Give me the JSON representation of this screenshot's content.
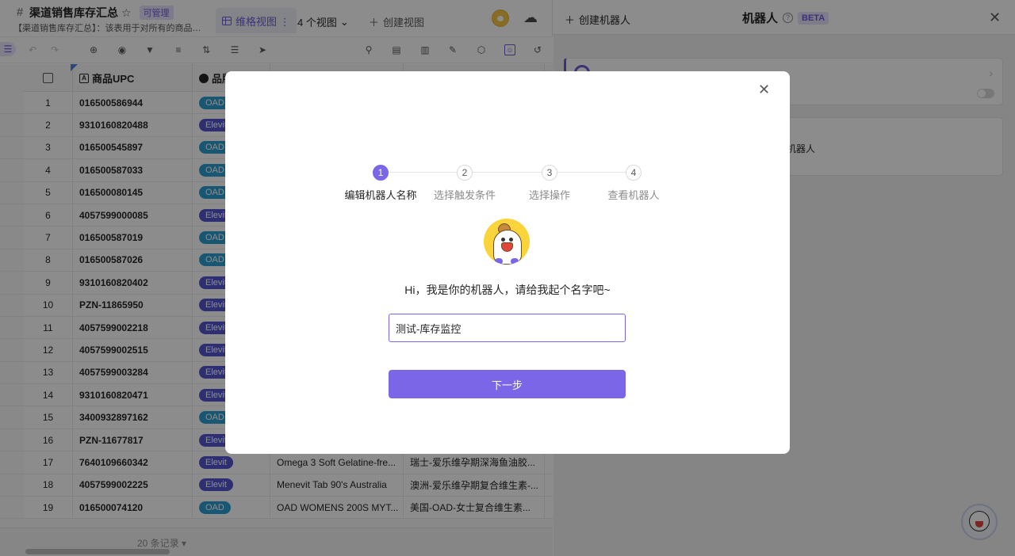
{
  "app": {
    "sheet_title": "渠道销售库存汇总",
    "permission_badge": "可管理",
    "sheet_desc": "【渠道销售库存汇总】：该表用于对所有的商品进行库存汇总",
    "view_tab_label": "维格视图 ⋮",
    "views_count": "4 个视图",
    "create_view_label": "创建视图"
  },
  "toolbar": {
    "icons": [
      "undo-icon",
      "redo-icon",
      "add-record-icon",
      "hide-fields-icon",
      "filter-icon",
      "group-icon",
      "sort-icon",
      "row-height-icon",
      "share-icon",
      "search-icon",
      "api-icon",
      "columns-icon",
      "widget-icon",
      "cube-icon",
      "robot-icon",
      "history-icon"
    ]
  },
  "grid": {
    "columns": [
      "商品UPC",
      "品牌"
    ],
    "rows": [
      {
        "idx": "1",
        "upc": "016500586944",
        "brand": "OAD",
        "name": "",
        "cn": ""
      },
      {
        "idx": "2",
        "upc": "9310160820488",
        "brand": "Elevit",
        "name": "",
        "cn": ""
      },
      {
        "idx": "3",
        "upc": "016500545897",
        "brand": "OAD",
        "name": "",
        "cn": ""
      },
      {
        "idx": "4",
        "upc": "016500587033",
        "brand": "OAD",
        "name": "",
        "cn": ""
      },
      {
        "idx": "5",
        "upc": "016500080145",
        "brand": "OAD",
        "name": "",
        "cn": ""
      },
      {
        "idx": "6",
        "upc": "4057599000085",
        "brand": "Elevit",
        "name": "",
        "cn": ""
      },
      {
        "idx": "7",
        "upc": "016500587019",
        "brand": "OAD",
        "name": "",
        "cn": ""
      },
      {
        "idx": "8",
        "upc": "016500587026",
        "brand": "OAD",
        "name": "",
        "cn": ""
      },
      {
        "idx": "9",
        "upc": "9310160820402",
        "brand": "Elevit",
        "name": "",
        "cn": ""
      },
      {
        "idx": "10",
        "upc": "PZN-11865950",
        "brand": "Elevit",
        "name": "",
        "cn": ""
      },
      {
        "idx": "11",
        "upc": "4057599002218",
        "brand": "Elevit",
        "name": "",
        "cn": ""
      },
      {
        "idx": "12",
        "upc": "4057599002515",
        "brand": "Elevit",
        "name": "",
        "cn": ""
      },
      {
        "idx": "13",
        "upc": "4057599003284",
        "brand": "Elevit",
        "name": "",
        "cn": ""
      },
      {
        "idx": "14",
        "upc": "9310160820471",
        "brand": "Elevit",
        "name": "",
        "cn": ""
      },
      {
        "idx": "15",
        "upc": "3400932897162",
        "brand": "OAD",
        "name": "",
        "cn": ""
      },
      {
        "idx": "16",
        "upc": "PZN-11677817",
        "brand": "Elevit",
        "name": "",
        "cn": ""
      },
      {
        "idx": "17",
        "upc": "7640109660342",
        "brand": "Elevit",
        "name": "Omega 3 Soft Gelatine-fre...",
        "cn": "瑞士-爱乐维孕期深海鱼油胶..."
      },
      {
        "idx": "18",
        "upc": "4057599002225",
        "brand": "Elevit",
        "name": "Menevit Tab 90's Australia",
        "cn": "澳洲-爱乐维孕期复合维生素-..."
      },
      {
        "idx": "19",
        "upc": "016500074120",
        "brand": "OAD",
        "name": "OAD WOMENS 200S MYT...",
        "cn": "美国-OAD-女士复合维生素..."
      }
    ],
    "record_count": "20 条记录 ▾"
  },
  "robot_panel": {
    "create_label": "创建机器人",
    "title": "机器人",
    "beta": "BETA",
    "card2_text": "机器人"
  },
  "modal": {
    "steps": [
      {
        "num": "1",
        "label": "编辑机器人名称"
      },
      {
        "num": "2",
        "label": "选择触发条件"
      },
      {
        "num": "3",
        "label": "选择操作"
      },
      {
        "num": "4",
        "label": "查看机器人"
      }
    ],
    "greeting": "Hi，我是你的机器人，请给我起个名字吧~",
    "name_value": "测试-库存监控",
    "next_label": "下一步"
  },
  "colors": {
    "accent": "#7b66e8",
    "pill_oad": "#2b9ed4",
    "pill_elevit": "#5556d0"
  }
}
